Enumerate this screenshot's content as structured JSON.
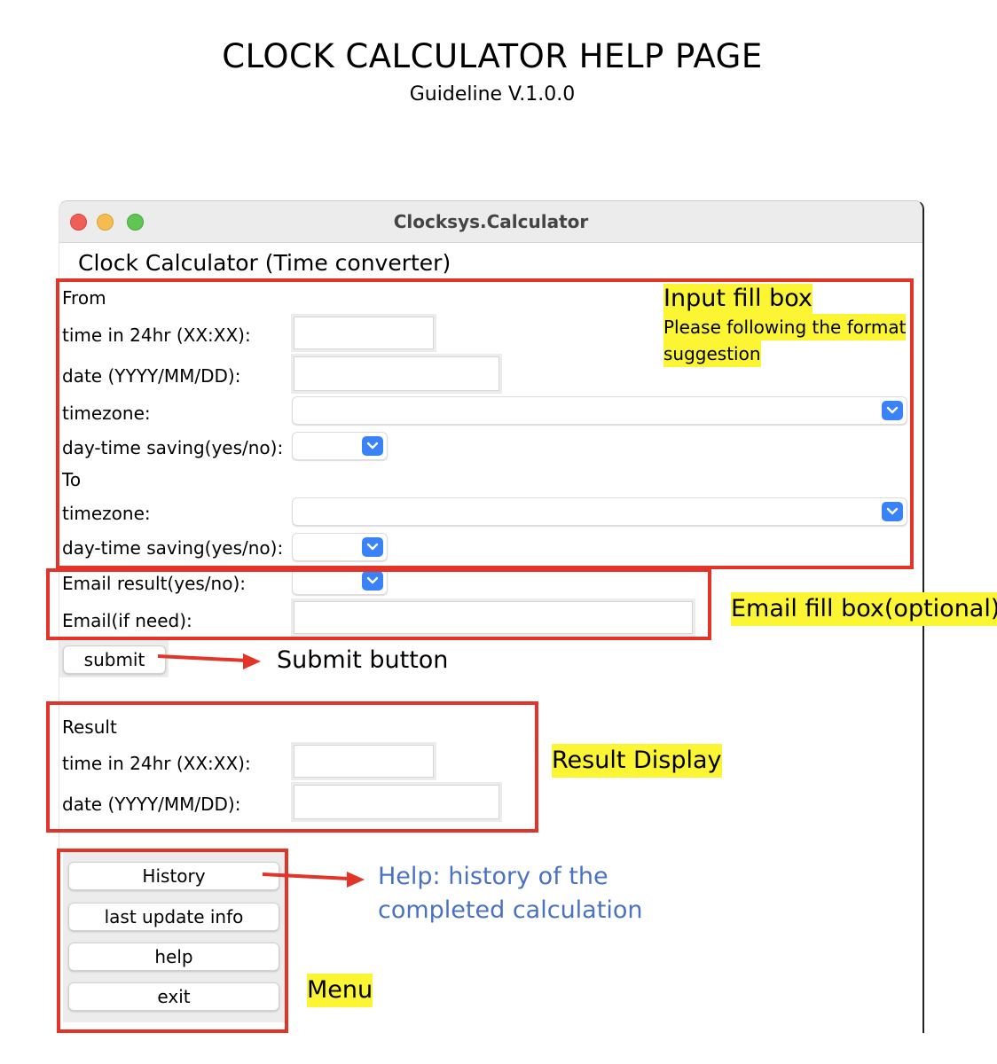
{
  "page": {
    "title": "CLOCK CALCULATOR HELP PAGE",
    "subtitle": "Guideline V.1.0.0"
  },
  "window": {
    "title": "Clocksys.Calculator",
    "heading": "Clock Calculator (Time converter)"
  },
  "form": {
    "from_label": "From",
    "time_label": "time in 24hr (XX:XX):",
    "date_label": "date (YYYY/MM/DD):",
    "timezone_label": "timezone:",
    "dst_label": "day-time saving(yes/no):",
    "to_label": "To",
    "to_timezone_label": "timezone:",
    "to_dst_label": "day-time saving(yes/no):",
    "email_result_label": "Email result(yes/no):",
    "email_label": "Email(if need):",
    "time_value": "",
    "date_value": "",
    "email_value": ""
  },
  "submit": {
    "label": "submit"
  },
  "result": {
    "label": "Result",
    "time_label": "time in 24hr (XX:XX):",
    "date_label": "date (YYYY/MM/DD):",
    "time_value": "",
    "date_value": ""
  },
  "menu": {
    "items": [
      "History",
      "last update info",
      "help",
      "exit"
    ]
  },
  "annotations": {
    "input_title": "Input fill box",
    "input_line1": "Please following the format",
    "input_line2": "suggestion",
    "email_box": "Email fill box(optional)",
    "submit_button": "Submit button",
    "result_display": "Result Display",
    "help_line1": "Help: history of the",
    "help_line2": "completed calculation",
    "menu": "Menu"
  },
  "colors": {
    "annotation_red": "#e3342a",
    "highlight_yellow": "#fbf534",
    "help_text_blue": "#4a72c4",
    "select_blue": "#3a82f7",
    "traffic_red": "#ee5f57",
    "traffic_yellow": "#f5bd4f",
    "traffic_green": "#5fc553"
  }
}
